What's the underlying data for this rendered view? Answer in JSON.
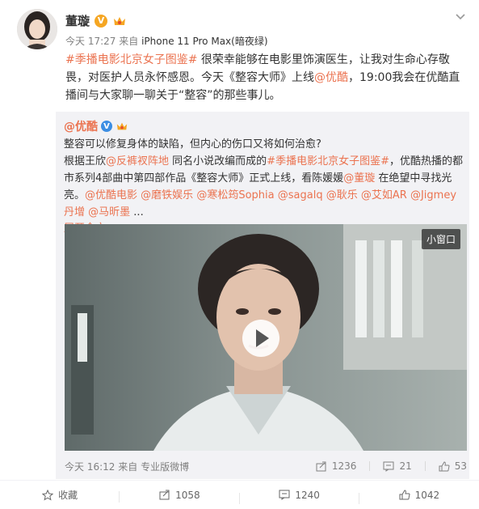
{
  "post": {
    "username": "董璇",
    "v_badge": "V",
    "meta_time": "今天 17:27",
    "meta_from": "来自",
    "meta_source": "iPhone 11 Pro Max(暗夜绿)",
    "text": {
      "hashtag": "#季播电影北京女子图鉴#",
      "p1": " 很荣幸能够在电影里饰演医生，让我对生命心存敬畏，对医护人员永怀感恩。今天《整容大师》上线",
      "mention": "@优酷",
      "p2": "，19:00我会在优酷直播间与大家聊一聊关于“整容”的那些事儿。"
    }
  },
  "repost": {
    "username": "@优酷",
    "v_badge": "V",
    "line1": "整容可以修复身体的缺陷，但内心的伤口又将如何治愈?",
    "t1": "根据王欣",
    "m1": "@反裤衩阵地",
    "t2": " 同名小说改编而成的",
    "h1": "#季播电影北京女子图鉴#",
    "t3": "，优酷热播的都市系列4部曲中第四部作品《整容大师》正式上线，看陈媛媛",
    "m2": "@董璇",
    "t4": " 在绝望中寻找光亮。",
    "m3": "@优酷电影",
    "m4": "@磨铁娱乐",
    "m5": "@寒松筠Sophia",
    "m6": "@sagalq",
    "m7": "@耿乐",
    "m8": "@艾如AR",
    "m9": "@Jigmey丹增",
    "m10": "@马昕墨",
    "ellipsis": " ...",
    "expand": "展开全文",
    "video_mini_window": "小窗口",
    "footer_time": "今天 16:12",
    "footer_from": "来自",
    "footer_source": "专业版微博",
    "stats": {
      "forward": "1236",
      "comment": "21",
      "like": "53"
    }
  },
  "actions": {
    "favorite": "收藏",
    "forward": "1058",
    "comment": "1240",
    "like": "1042"
  },
  "colors": {
    "link": "#eb7350",
    "repost_bg": "#f2f2f5",
    "v_gold": "#f5a623",
    "v_blue": "#3c8ee3"
  }
}
